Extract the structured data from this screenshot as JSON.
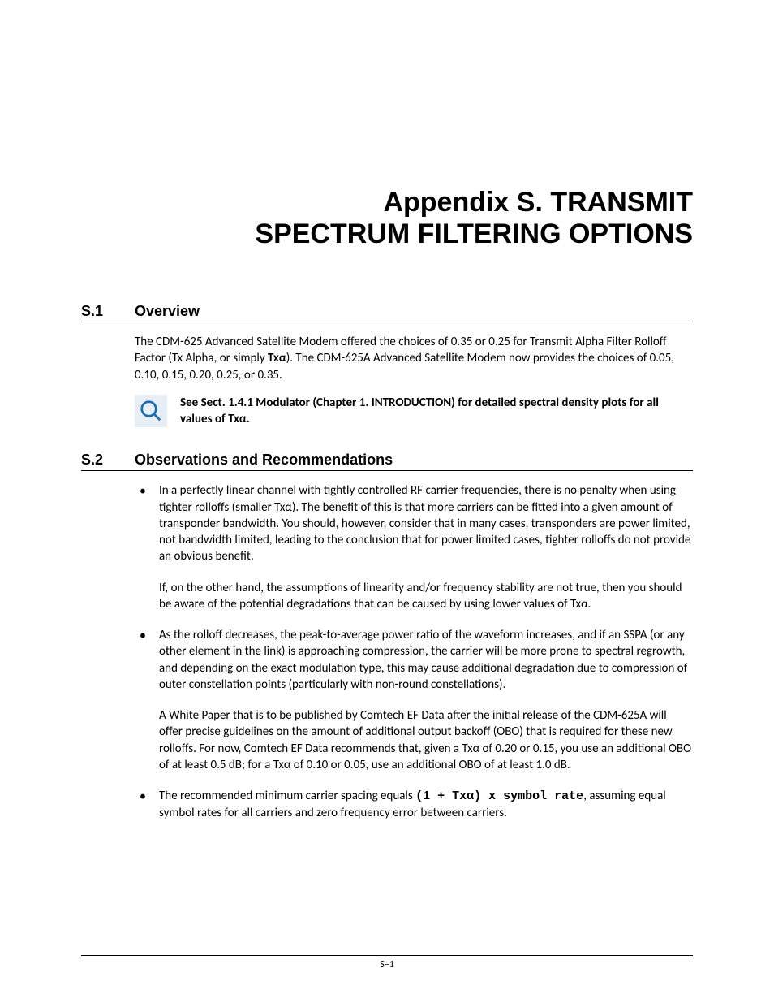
{
  "title": {
    "line1": "Appendix S. TRANSMIT",
    "line2": "SPECTRUM FILTERING OPTIONS"
  },
  "s1": {
    "num": "S.1",
    "heading": "Overview",
    "para1_a": "The CDM-625 Advanced Satellite Modem offered the choices of 0.35 or 0.25 for Transmit Alpha Filter Rolloff Factor (Tx Alpha, or simply ",
    "para1_b_bold": "Txα",
    "para1_c": "). The CDM-625A Advanced Satellite Modem now provides the choices of 0.05, 0.10, 0.15, 0.20, 0.25, or 0.35.",
    "note": "See Sect. 1.4.1 Modulator (Chapter 1. INTRODUCTION) for detailed spectral density plots for all values of Txα."
  },
  "s2": {
    "num": "S.2",
    "heading": "Observations and Recommendations",
    "b1p1": "In a perfectly linear channel with tightly controlled RF carrier frequencies, there is no penalty when using tighter rolloffs (smaller Txα). The benefit of this is that more carriers can be fitted into a given amount of transponder bandwidth. You should, however, consider that in many cases, transponders are power limited, not bandwidth limited, leading to the conclusion that for power limited cases, tighter rolloffs do not provide an obvious benefit.",
    "b1p2": "If, on the other hand, the assumptions of linearity and/or frequency stability are not true, then you should be aware of the potential degradations that can be caused by using lower values of Txα.",
    "b2p1": "As the rolloff decreases, the peak-to-average power ratio of the waveform increases, and if an SSPA (or any other element in the link) is approaching compression, the carrier will be more prone to spectral regrowth, and depending on the exact modulation type, this may cause additional degradation due to compression of outer constellation points (particularly with non-round constellations).",
    "b2p2": "A White Paper that is to be published by Comtech EF Data after the initial release of the CDM-625A will offer precise guidelines on the amount of additional output backoff (OBO) that is required for these new rolloffs. For now, Comtech EF Data recommends that, given a Txα of 0.20 or 0.15, you use an additional OBO of at least 0.5 dB; for a Txα of 0.10 or 0.05, use an additional OBO of at least 1.0 dB.",
    "b3_a": "The recommended minimum carrier spacing equals ",
    "b3_mono": "(1 + Txα) x symbol rate",
    "b3_c": ", assuming equal symbol rates for all carriers and zero frequency error between carriers."
  },
  "footer": "S–1",
  "icon_name": "magnifier-icon"
}
